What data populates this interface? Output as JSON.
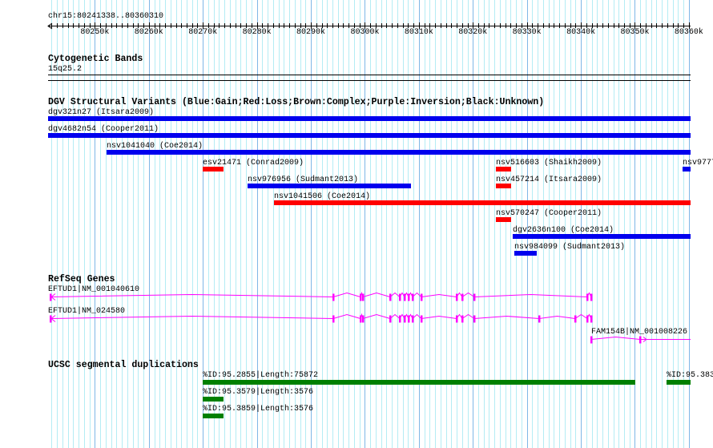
{
  "region": {
    "label": "chr15:80241338..80360310",
    "chrom": "chr15",
    "start": 80241338,
    "end": 80360310
  },
  "ruler": {
    "ticks": [
      "80250k",
      "80260k",
      "80270k",
      "80280k",
      "80290k",
      "80300k",
      "80310k",
      "80320k",
      "80330k",
      "80340k",
      "80350k",
      "80360k"
    ]
  },
  "colors": {
    "grid_minor": "#b4ecf4",
    "grid_major": "#7fb7e6",
    "gain": "#0000ee",
    "loss": "#ff0000",
    "gene": "#ff00ff",
    "segdup": "#008000"
  },
  "tracks": {
    "cyto": {
      "title": "Cytogenetic Bands",
      "band": "15q25.2"
    },
    "dgv": {
      "title": "DGV Structural Variants (Blue:Gain;Red:Loss;Brown:Complex;Purple:Inversion;Black:Unknown)",
      "features": [
        {
          "label": "dgv321n27 (Itsara2009)",
          "start": 80241338,
          "end": 80360310,
          "type": "gain",
          "row": 0
        },
        {
          "label": "dgv4682n54 (Cooper2011)",
          "start": 80241338,
          "end": 80360310,
          "type": "gain",
          "row": 1
        },
        {
          "label": "nsv1041040 (Coe2014)",
          "start": 80252170,
          "end": 80360310,
          "type": "gain",
          "row": 2
        },
        {
          "label": "esv21471 (Conrad2009)",
          "start": 80269968,
          "end": 80273825,
          "type": "loss",
          "row": 3
        },
        {
          "label": "nsv516603 (Shaikh2009)",
          "start": 80324260,
          "end": 80327080,
          "type": "loss",
          "row": 3
        },
        {
          "label": "nsv9777",
          "start": 80358825,
          "end": 80360310,
          "type": "gain",
          "row": 3
        },
        {
          "label": "nsv976956 (Sudmant2013)",
          "start": 80278275,
          "end": 80308536,
          "type": "gain",
          "row": 4
        },
        {
          "label": "nsv457214 (Itsara2009)",
          "start": 80324260,
          "end": 80327080,
          "type": "loss",
          "row": 4
        },
        {
          "label": "nsv1041506 (Coe2014)",
          "start": 80283170,
          "end": 80360310,
          "type": "loss",
          "row": 5
        },
        {
          "label": "nsv570247 (Cooper2011)",
          "start": 80324260,
          "end": 80327080,
          "type": "loss",
          "row": 6
        },
        {
          "label": "dgv2636n100 (Coe2014)",
          "start": 80327375,
          "end": 80360310,
          "type": "gain",
          "row": 7
        },
        {
          "label": "nsv984099 (Sudmant2013)",
          "start": 80327670,
          "end": 80331825,
          "type": "gain",
          "row": 8
        }
      ]
    },
    "refseq": {
      "title": "RefSeq Genes",
      "genes": [
        {
          "label": "EFTUD1|NM_001040610",
          "strand": "-",
          "start": 80241783,
          "end": 80341910,
          "exons": [
            80241783,
            80294147,
            80299190,
            80299635,
            80304680,
            80306460,
            80307350,
            80308090,
            80308830,
            80310460,
            80316990,
            80318030,
            80320250,
            80341170,
            80341910
          ]
        },
        {
          "label": "EFTUD1|NM_024580",
          "strand": "-",
          "start": 80241783,
          "end": 80341910,
          "exons": [
            80241783,
            80294147,
            80299190,
            80299635,
            80304680,
            80306460,
            80307350,
            80308090,
            80308830,
            80310460,
            80316990,
            80318030,
            80320250,
            80332270,
            80338945,
            80341170,
            80341910
          ]
        },
        {
          "label": "FAM154B|NM_001008226",
          "strand": "+",
          "start": 80341910,
          "end": 80360310,
          "exons": [
            80341910,
            80350960
          ]
        }
      ]
    },
    "segdup": {
      "title": "UCSC segmental duplications",
      "features": [
        {
          "label": "%ID:95.2855|Length:75872",
          "start": 80269968,
          "end": 80350070,
          "row": 0
        },
        {
          "label": "%ID:95.383",
          "start": 80355855,
          "end": 80360310,
          "row": 0
        },
        {
          "label": "%ID:95.3579|Length:3576",
          "start": 80269968,
          "end": 80273825,
          "row": 1
        },
        {
          "label": "%ID:95.3859|Length:3576",
          "start": 80269968,
          "end": 80273825,
          "row": 2
        }
      ]
    }
  }
}
